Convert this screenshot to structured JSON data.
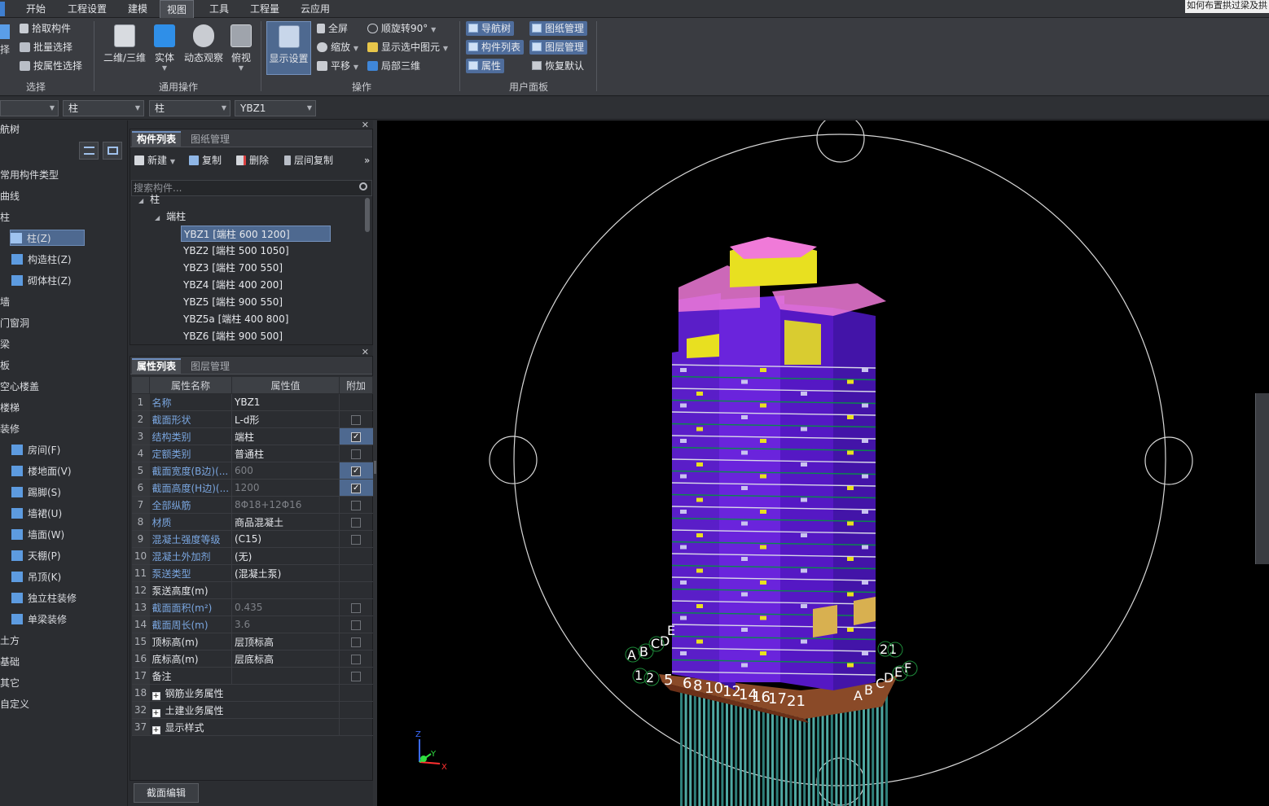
{
  "menubar": {
    "tabs": [
      "开始",
      "工程设置",
      "建模",
      "视图",
      "工具",
      "工程量",
      "云应用"
    ],
    "active_tab": "视图",
    "help_link": "如何布置拱过梁及拱"
  },
  "ribbon": {
    "select_group": {
      "label": "选择",
      "pick": "拾取构件",
      "batch": "批量选择",
      "by_attr": "按属性选择",
      "left_cut": "择"
    },
    "common_ops": {
      "label": "通用操作",
      "view2d3d": "二维/三维",
      "solid": "实体",
      "orbit": "动态观察",
      "topview": "俯视"
    },
    "operations": {
      "label": "操作",
      "display_settings": "显示设置",
      "fullscreen": "全屏",
      "zoom": "缩放",
      "pan": "平移",
      "rotate": "顺旋转90°",
      "show_selected": "显示选中图元",
      "local_3d": "局部三维"
    },
    "user_panel": {
      "label": "用户面板",
      "nav_tree": "导航树",
      "drawing_mgmt": "图纸管理",
      "component_list": "构件列表",
      "layer_mgmt": "图层管理",
      "properties": "属性",
      "restore_default": "恢复默认"
    }
  },
  "selectors": {
    "floor": "",
    "category": "柱",
    "type": "柱",
    "component": "YBZ1"
  },
  "navtree": {
    "title": "航树",
    "items": [
      {
        "label": "常用构件类型",
        "indent": 0
      },
      {
        "label": "曲线",
        "indent": 0
      },
      {
        "label": "柱",
        "indent": 0
      },
      {
        "label": "柱(Z)",
        "indent": 1,
        "selected": true,
        "icon": "column-icon"
      },
      {
        "label": "构造柱(Z)",
        "indent": 1,
        "icon": "construction-column-icon"
      },
      {
        "label": "砌体柱(Z)",
        "indent": 1,
        "icon": "masonry-column-icon"
      },
      {
        "label": "墙",
        "indent": 0
      },
      {
        "label": "门窗洞",
        "indent": 0
      },
      {
        "label": "梁",
        "indent": 0
      },
      {
        "label": "板",
        "indent": 0
      },
      {
        "label": "空心楼盖",
        "indent": 0
      },
      {
        "label": "楼梯",
        "indent": 0
      },
      {
        "label": "装修",
        "indent": 0
      },
      {
        "label": "房间(F)",
        "indent": 1,
        "icon": "room-icon"
      },
      {
        "label": "楼地面(V)",
        "indent": 1,
        "icon": "floor-icon"
      },
      {
        "label": "踢脚(S)",
        "indent": 1,
        "icon": "skirting-icon"
      },
      {
        "label": "墙裙(U)",
        "indent": 1,
        "icon": "dado-icon"
      },
      {
        "label": "墙面(W)",
        "indent": 1,
        "icon": "wall-surface-icon"
      },
      {
        "label": "天棚(P)",
        "indent": 1,
        "icon": "ceiling-icon"
      },
      {
        "label": "吊顶(K)",
        "indent": 1,
        "icon": "suspended-ceiling-icon"
      },
      {
        "label": "独立柱装修",
        "indent": 1,
        "icon": "column-finish-icon"
      },
      {
        "label": "单梁装修",
        "indent": 1,
        "icon": "beam-finish-icon"
      },
      {
        "label": "土方",
        "indent": 0
      },
      {
        "label": "基础",
        "indent": 0
      },
      {
        "label": "其它",
        "indent": 0
      },
      {
        "label": "自定义",
        "indent": 0
      }
    ]
  },
  "component_panel": {
    "tabs": [
      "构件列表",
      "图纸管理"
    ],
    "toolbar": {
      "new": "新建",
      "copy": "复制",
      "delete": "删除",
      "floor_copy": "层间复制",
      "more": "»"
    },
    "search_placeholder": "搜索构件...",
    "tree": {
      "root": "柱",
      "group": "端柱",
      "items": [
        "YBZ1 [端柱 600 1200]",
        "YBZ2 [端柱 500 1050]",
        "YBZ3 [端柱 700 550]",
        "YBZ4 [端柱 400 200]",
        "YBZ5 [端柱 900 550]",
        "YBZ5a [端柱 400 800]",
        "YBZ6 [端柱 900 500]"
      ],
      "selected_index": 0
    }
  },
  "property_panel": {
    "tabs": [
      "属性列表",
      "图层管理"
    ],
    "headers": [
      "属性名称",
      "属性值",
      "附加"
    ],
    "rows": [
      {
        "num": "1",
        "name": "名称",
        "value": "YBZ1",
        "check": "none",
        "blue": true
      },
      {
        "num": "2",
        "name": "截面形状",
        "value": "L-d形",
        "check": "off",
        "blue": true
      },
      {
        "num": "3",
        "name": "结构类别",
        "value": "端柱",
        "check": "on",
        "blue": true
      },
      {
        "num": "4",
        "name": "定额类别",
        "value": "普通柱",
        "check": "off",
        "blue": true
      },
      {
        "num": "5",
        "name": "截面宽度(B边)(...",
        "value": "600",
        "check": "on",
        "blue": true,
        "dim": true
      },
      {
        "num": "6",
        "name": "截面高度(H边)(...",
        "value": "1200",
        "check": "on",
        "blue": true,
        "dim": true
      },
      {
        "num": "7",
        "name": "全部纵筋",
        "value": "8Φ18+12Φ16",
        "check": "off",
        "blue": true,
        "dim": true
      },
      {
        "num": "8",
        "name": "材质",
        "value": "商品混凝土",
        "check": "off",
        "blue": true
      },
      {
        "num": "9",
        "name": "混凝土强度等级",
        "value": "(C15)",
        "check": "off",
        "blue": true
      },
      {
        "num": "10",
        "name": "混凝土外加剂",
        "value": "(无)",
        "check": "none",
        "blue": true
      },
      {
        "num": "11",
        "name": "泵送类型",
        "value": "(混凝土泵)",
        "check": "none",
        "blue": true
      },
      {
        "num": "12",
        "name": "泵送高度(m)",
        "value": "",
        "check": "none",
        "blue": false
      },
      {
        "num": "13",
        "name": "截面面积(m²)",
        "value": "0.435",
        "check": "off",
        "blue": true,
        "dim": true
      },
      {
        "num": "14",
        "name": "截面周长(m)",
        "value": "3.6",
        "check": "off",
        "blue": true,
        "dim": true
      },
      {
        "num": "15",
        "name": "顶标高(m)",
        "value": "层顶标高",
        "check": "off",
        "blue": false
      },
      {
        "num": "16",
        "name": "底标高(m)",
        "value": "层底标高",
        "check": "off",
        "blue": false
      },
      {
        "num": "17",
        "name": "备注",
        "value": "",
        "check": "off",
        "blue": false
      },
      {
        "num": "18",
        "name": "钢筋业务属性",
        "value": "",
        "check": "none",
        "blue": false,
        "expand": true
      },
      {
        "num": "32",
        "name": "土建业务属性",
        "value": "",
        "check": "none",
        "blue": false,
        "expand": true
      },
      {
        "num": "37",
        "name": "显示样式",
        "value": "",
        "check": "none",
        "blue": false,
        "expand": true
      }
    ]
  },
  "section_edit_button": "截面编辑",
  "viewport": {
    "axis_labels": {
      "x": "X",
      "y": "Y",
      "z": "Z"
    },
    "grid_labels_left": [
      "A",
      "B",
      "C",
      "D",
      "E",
      "1",
      "2",
      "5",
      "6",
      "8",
      "10",
      "12",
      "14",
      "16",
      "17",
      "21"
    ],
    "grid_labels_right": [
      "2",
      "1",
      "A",
      "B",
      "C",
      "D",
      "E",
      "F"
    ]
  },
  "colors": {
    "accent": "#4e6990",
    "tower_purple": "#6a1fd6",
    "tower_yellow": "#e8e020",
    "tower_green": "#0a8a4a",
    "roof_pink": "#f07ad8",
    "base_brown": "#8a4a28",
    "piles_teal": "#4fa8a2"
  }
}
